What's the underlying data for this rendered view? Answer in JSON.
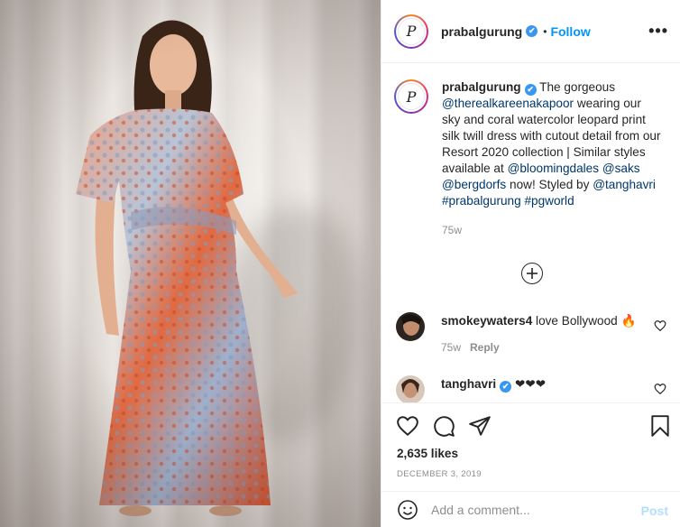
{
  "post": {
    "username": "prabalgurung",
    "verified_badge": "✔",
    "separator": "•",
    "follow_label": "Follow",
    "more_label": "•••",
    "avatar_monogram": "P"
  },
  "caption": {
    "username": "prabalgurung",
    "text_1": " The gorgeous ",
    "mention_1": "@therealkareenakapoor",
    "text_2": " wearing our sky and coral watercolor leopard print silk twill dress with cutout detail from our Resort 2020 collection | Similar styles available at ",
    "mention_2": "@bloomingdales",
    "text_3": " ",
    "mention_3": "@saks",
    "text_4": " ",
    "mention_4": "@bergdorfs",
    "text_5": " now! Styled by ",
    "mention_5": "@tanghavri",
    "text_6": " ",
    "hashtag_1": "#prabalgurung",
    "text_7": " ",
    "hashtag_2": "#pgworld",
    "time": "75w"
  },
  "load_more_icon": "⊕",
  "comments": [
    {
      "username": "smokeywaters4",
      "text": "love Bollywood ",
      "emoji": "🔥",
      "time": "75w",
      "reply_label": "Reply"
    },
    {
      "username": "tanghavri",
      "verified": true,
      "text": "❤❤❤"
    }
  ],
  "actions": {
    "icons": [
      "heart-icon",
      "comment-icon",
      "share-icon",
      "bookmark-icon"
    ],
    "likes": "2,635 likes",
    "date": "DECEMBER 3, 2019"
  },
  "add_comment": {
    "placeholder": "Add a comment...",
    "post_label": "Post"
  },
  "colors": {
    "link": "#00376b",
    "follow": "#0095f6",
    "verified": "#3897f0",
    "muted": "#8e8e8e",
    "post_disabled": "#b2dffc"
  }
}
